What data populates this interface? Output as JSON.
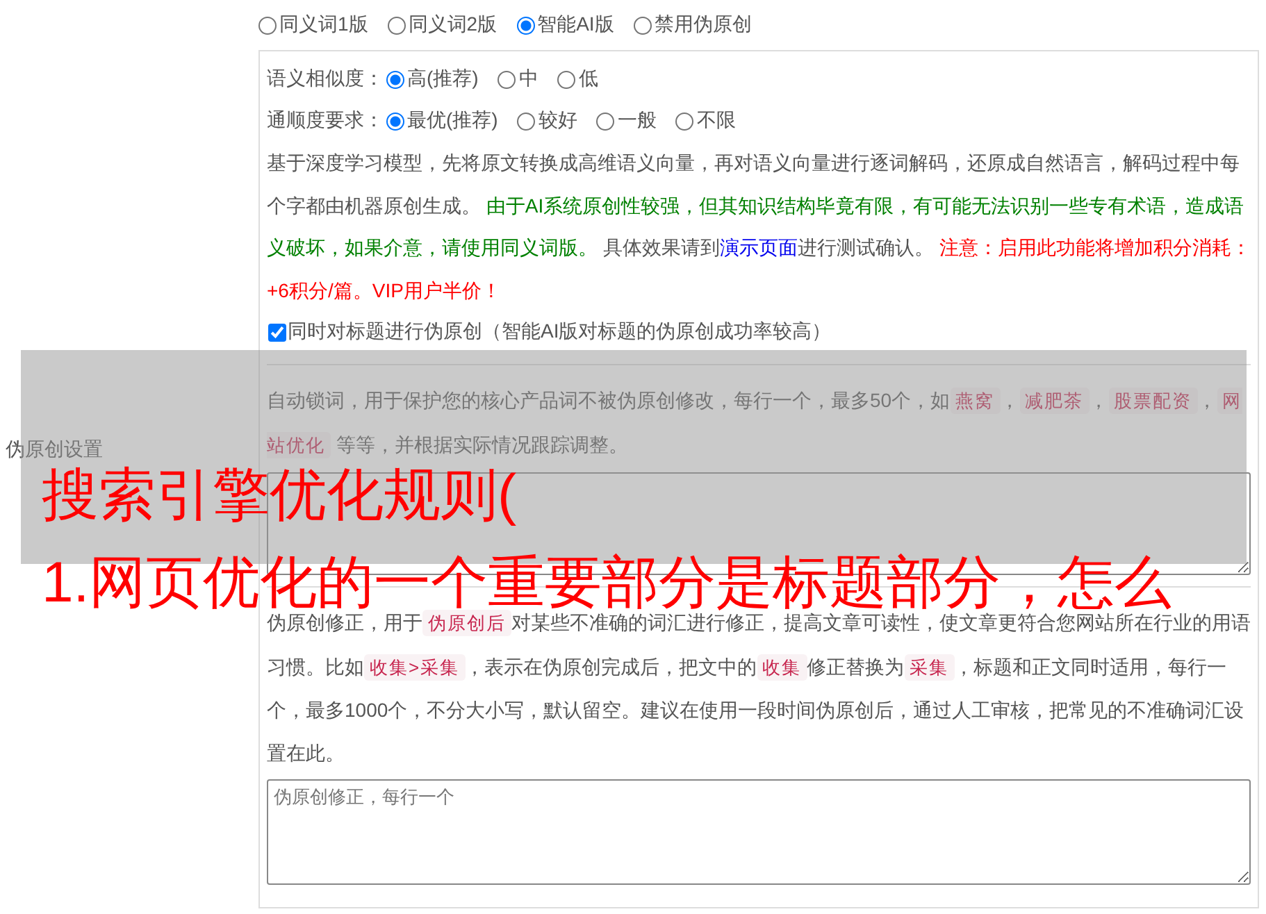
{
  "section_label": "伪原创设置",
  "mode_options": [
    {
      "label": "同义词1版",
      "selected": false
    },
    {
      "label": "同义词2版",
      "selected": false
    },
    {
      "label": "智能AI版",
      "selected": true
    },
    {
      "label": "禁用伪原创",
      "selected": false
    }
  ],
  "similarity": {
    "label": "语义相似度：",
    "options": [
      {
        "label": "高(推荐)",
        "selected": true
      },
      {
        "label": "中",
        "selected": false
      },
      {
        "label": "低",
        "selected": false
      }
    ]
  },
  "fluency": {
    "label": "通顺度要求：",
    "options": [
      {
        "label": "最优(推荐)",
        "selected": true
      },
      {
        "label": "较好",
        "selected": false
      },
      {
        "label": "一般",
        "selected": false
      },
      {
        "label": "不限",
        "selected": false
      }
    ]
  },
  "ai_description": [
    {
      "kind": "plain",
      "text": "基于深度学习模型，先将原文转换成高维语义向量，再对语义向量进行逐词解码，还原成自然语言，解码过程中每个字都由机器原创生成。 "
    },
    {
      "kind": "notice",
      "text": "由于AI系统原创性较强，但其知识结构毕竟有限，有可能无法识别一些专有术语，造成语义破坏，如果介意，请使用同义词版。"
    },
    {
      "kind": "plain",
      "text": " 具体效果请到"
    },
    {
      "kind": "link",
      "text": "演示页面"
    },
    {
      "kind": "plain",
      "text": "进行测试确认。 "
    },
    {
      "kind": "warning",
      "text": "注意：启用此功能将增加积分消耗：+6积分/篇。VIP用户半价！"
    }
  ],
  "title_option": {
    "label": "同时对标题进行伪原创（智能AI版对标题的伪原创成功率较高）",
    "checked": true
  },
  "lock_words": {
    "description": [
      {
        "kind": "plain",
        "text": "自动锁词，用于保护您的核心产品词不被伪原创修改，每行一个，最多50个，如"
      },
      {
        "kind": "code",
        "text": "燕窝"
      },
      {
        "kind": "plain",
        "text": "，"
      },
      {
        "kind": "code",
        "text": "减肥茶"
      },
      {
        "kind": "plain",
        "text": "，"
      },
      {
        "kind": "code",
        "text": "股票配资"
      },
      {
        "kind": "plain",
        "text": "，"
      },
      {
        "kind": "code",
        "text": "网站优化"
      },
      {
        "kind": "plain",
        "text": " 等等，并根据实际情况跟踪调整。"
      }
    ]
  },
  "corrections": {
    "description": [
      {
        "kind": "plain",
        "text": "伪原创修正，用于"
      },
      {
        "kind": "code",
        "text": "伪原创后"
      },
      {
        "kind": "plain",
        "text": "对某些不准确的词汇进行修正，提高文章可读性，使文章更符合您网站所在行业的用语习惯。比如"
      },
      {
        "kind": "code",
        "text": "收集>采集"
      },
      {
        "kind": "plain",
        "text": "，表示在伪原创完成后，把文中的"
      },
      {
        "kind": "code",
        "text": "收集"
      },
      {
        "kind": "plain",
        "text": "修正替换为"
      },
      {
        "kind": "code",
        "text": "采集"
      },
      {
        "kind": "plain",
        "text": "，标题和正文同时适用，每行一个，最多1000个，不分大小写，默认留空。建议在使用一段时间伪原创后，通过人工审核，把常见的不准确词汇设置在此。"
      }
    ],
    "placeholder": "伪原创修正，每行一个"
  },
  "overlay": {
    "lines": [
      "搜索引擎优化规则(",
      "1.网页优化的一个重要部分是标题部分，怎么"
    ]
  }
}
